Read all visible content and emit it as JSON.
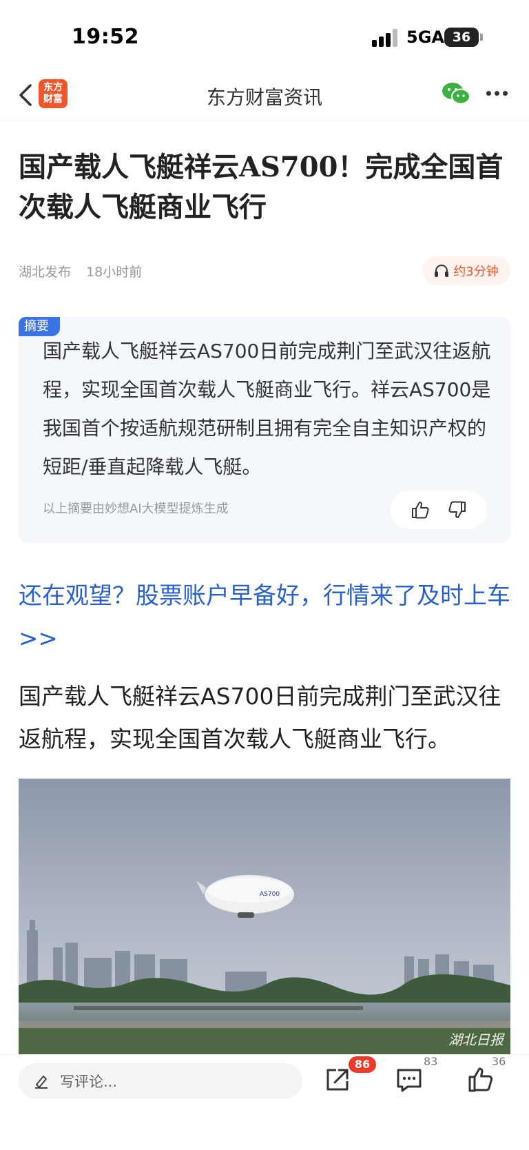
{
  "status_bar": {
    "time": "19:52",
    "network": "5GA",
    "battery": "36"
  },
  "nav": {
    "back_icon": "chevron-left-icon",
    "logo_text_line1": "东方",
    "logo_text_line2": "财富",
    "title": "东方财富资讯",
    "share_icon": "wechat-icon",
    "more_icon": "more-icon"
  },
  "article": {
    "title": "国产载人飞艇祥云AS700！完成全国首次载人飞艇商业飞行",
    "source": "湖北发布",
    "time_ago": "18小时前",
    "listen_label": "约3分钟",
    "listen_icon": "headphones-icon"
  },
  "summary": {
    "badge": "摘要",
    "text": "国产载人飞艇祥云AS700日前完成荆门至武汉往返航程，实现全国首次载人飞艇商业飞行。祥云AS700是我国首个按适航规范研制且拥有完全自主知识产权的短距/垂直起降载人飞艇。",
    "note": "以上摘要由妙想AI大模型提炼生成"
  },
  "promo_link": "还在观望？股票账户早备好，行情来了及时上车>>",
  "body_paragraph": "国产载人飞艇祥云AS700日前完成荆门至武汉往返航程，实现全国首次载人飞艇商业飞行。",
  "photo": {
    "watermark": "湖北日报",
    "airship_label": "AS700"
  },
  "bottom_bar": {
    "comment_placeholder": "写评论...",
    "share_badge": "86",
    "comment_count": "83",
    "like_count": "36"
  },
  "colors": {
    "accent_orange": "#ee5a2a",
    "link_blue": "#2a62c9",
    "summary_badge_blue": "#3a73e6",
    "badge_red": "#ee3a2a"
  }
}
